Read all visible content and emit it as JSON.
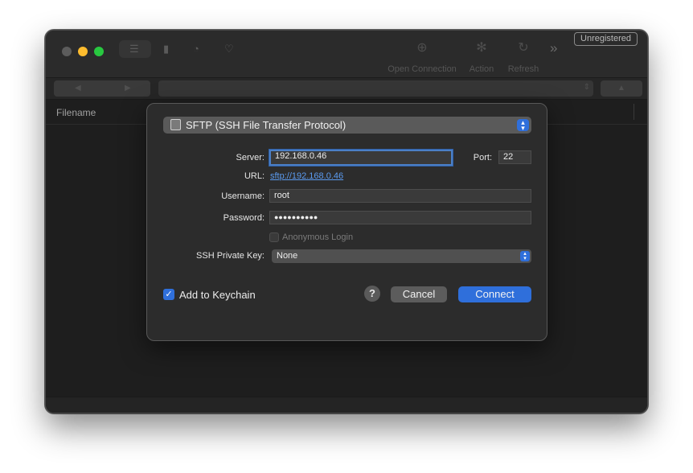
{
  "toolbar": {
    "unregistered_label": "Unregistered",
    "open_connection_label": "Open Connection",
    "action_label": "Action",
    "refresh_label": "Refresh",
    "overflow_glyph": "»"
  },
  "browser": {
    "column_filename": "Filename"
  },
  "dialog": {
    "protocol": "SFTP (SSH File Transfer Protocol)",
    "server_label": "Server:",
    "server_value": "192.168.0.46",
    "port_label": "Port:",
    "port_value": "22",
    "url_label": "URL:",
    "url_value": "sftp://192.168.0.46",
    "username_label": "Username:",
    "username_value": "root",
    "password_label": "Password:",
    "password_value": "●●●●●●●●●●",
    "anonymous_label": "Anonymous Login",
    "anonymous_checked": false,
    "ssh_key_label": "SSH Private Key:",
    "ssh_key_value": "None",
    "keychain_label": "Add to Keychain",
    "keychain_checked": true,
    "help_label": "?",
    "cancel_label": "Cancel",
    "connect_label": "Connect"
  },
  "colors": {
    "accent": "#2f6fdb",
    "link": "#5b9bf0"
  }
}
